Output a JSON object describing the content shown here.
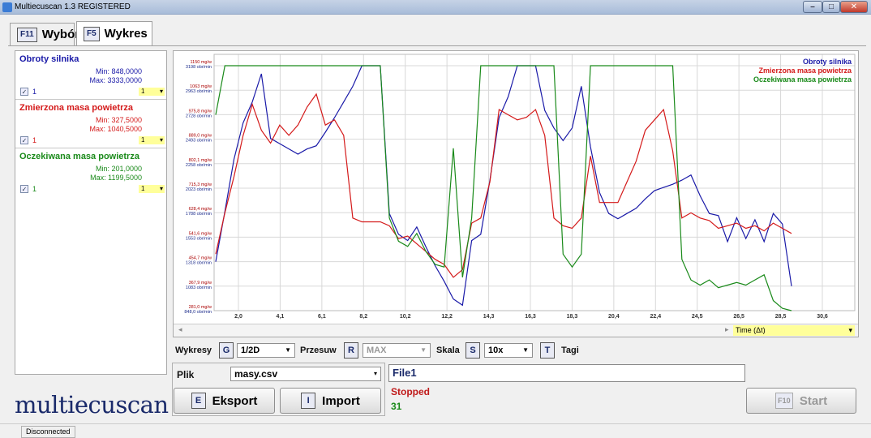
{
  "window": {
    "title": "Multiecuscan 1.3 REGISTERED"
  },
  "tabs": [
    {
      "key": "F11",
      "label": "Wybór"
    },
    {
      "key": "F5",
      "label": "Wykres"
    }
  ],
  "sensors": [
    {
      "name": "Obroty silnika",
      "min": "Min: 848,0000",
      "max": "Max: 3333,0000",
      "check": "1",
      "select": "1",
      "color": "#1a1aa8"
    },
    {
      "name": "Zmierzona masa powietrza",
      "min": "Min: 327,5000",
      "max": "Max: 1040,5000",
      "check": "1",
      "select": "1",
      "color": "#d41a1a"
    },
    {
      "name": "Oczekiwana masa powietrza",
      "min": "Min: 201,0000",
      "max": "Max: 1199,5000",
      "check": "1",
      "select": "1",
      "color": "#1a8a1a"
    }
  ],
  "chart_data": {
    "type": "line",
    "legend": [
      "Obroty silnika",
      "Zmierzona masa powietrza",
      "Oczekiwana masa powietrza"
    ],
    "legend_position": "top-right",
    "grid": true,
    "x_ticks": [
      "2,0",
      "4,1",
      "6,1",
      "8,2",
      "10,2",
      "12,2",
      "14,3",
      "16,3",
      "18,3",
      "20,4",
      "22,4",
      "24,5",
      "26,5",
      "28,5",
      "30,6"
    ],
    "y_ticks_left_mg": [
      "1150 mg/w",
      "1063 mg/w",
      "975,8 mg/w",
      "889,0 mg/w",
      "802,1 mg/w",
      "715,3 mg/w",
      "628,4 mg/w",
      "541,6 mg/w",
      "454,7 mg/w",
      "367,9 mg/w",
      "281,0 mg/w"
    ],
    "y_ticks_left_rpm": [
      "3198 obr/min",
      "2963 obr/min",
      "2728 obr/min",
      "2493 obr/min",
      "2258 obr/min",
      "2023 obr/min",
      "1788 obr/min",
      "1553 obr/min",
      "1318 obr/min",
      "1083 obr/min",
      "848,0 obr/min"
    ],
    "x_axis_label": "Time (Δt)",
    "series": [
      {
        "name": "Obroty silnika",
        "color": "#1a1aa8",
        "x": [
          0,
          1,
          2,
          3,
          4,
          5,
          6,
          7,
          8,
          9,
          10,
          11,
          12,
          13,
          14,
          15,
          16,
          17,
          18,
          19,
          20,
          21,
          22,
          23,
          24,
          25,
          26,
          27,
          28,
          29,
          30,
          31,
          32,
          33,
          34,
          35,
          36,
          37,
          38,
          39,
          40,
          41,
          42,
          43,
          44,
          45,
          46,
          47,
          48,
          49,
          50,
          51,
          52,
          53,
          54,
          55,
          56,
          57,
          58,
          59,
          60,
          61,
          62,
          63
        ],
        "y": [
          1318,
          1800,
          2300,
          2650,
          2850,
          3120,
          2500,
          2450,
          2400,
          2350,
          2400,
          2430,
          2560,
          2700,
          2850,
          3000,
          3198,
          3198,
          3198,
          1780,
          1580,
          1520,
          1650,
          1460,
          1280,
          1130,
          960,
          900,
          1520,
          1580,
          2100,
          2700,
          2900,
          3198,
          3198,
          3198,
          2770,
          2600,
          2480,
          2600,
          3000,
          2420,
          1980,
          1780,
          1730,
          1780,
          1830,
          1920,
          2000,
          2030,
          2060,
          2100,
          2150,
          1950,
          1780,
          1760,
          1510,
          1740,
          1540,
          1720,
          1510,
          1780,
          1680,
          1083
        ]
      },
      {
        "name": "Zmierzona masa powietrza",
        "color": "#d41a1a",
        "x": [
          0,
          1,
          2,
          3,
          4,
          5,
          6,
          7,
          8,
          9,
          10,
          11,
          12,
          13,
          14,
          15,
          16,
          17,
          18,
          19,
          20,
          21,
          22,
          23,
          24,
          25,
          26,
          27,
          28,
          29,
          30,
          31,
          32,
          33,
          34,
          35,
          36,
          37,
          38,
          39,
          40,
          41,
          42,
          43,
          44,
          45,
          46,
          47,
          48,
          49,
          50,
          51,
          52,
          53,
          54,
          55,
          56,
          57,
          58,
          59,
          60,
          61,
          62,
          63
        ],
        "y": [
          420,
          580,
          720,
          880,
          1000,
          900,
          850,
          920,
          880,
          920,
          990,
          1040,
          920,
          940,
          880,
          560,
          545,
          545,
          545,
          530,
          480,
          490,
          460,
          430,
          400,
          380,
          330,
          360,
          540,
          560,
          700,
          980,
          960,
          940,
          950,
          980,
          880,
          560,
          530,
          520,
          560,
          800,
          620,
          620,
          620,
          700,
          780,
          900,
          940,
          980,
          820,
          560,
          580,
          560,
          550,
          520,
          530,
          540,
          520,
          530,
          510,
          540,
          520,
          500
        ]
      },
      {
        "name": "Oczekiwana masa powietrza",
        "color": "#1a8a1a",
        "x": [
          0,
          1,
          2,
          3,
          4,
          5,
          6,
          7,
          8,
          9,
          10,
          11,
          12,
          13,
          14,
          15,
          16,
          17,
          18,
          19,
          20,
          21,
          22,
          23,
          24,
          25,
          26,
          27,
          28,
          29,
          30,
          31,
          32,
          33,
          34,
          35,
          36,
          37,
          38,
          39,
          40,
          41,
          42,
          43,
          44,
          45,
          46,
          47,
          48,
          49,
          50,
          51,
          52,
          53,
          54,
          55,
          56,
          57,
          58,
          59,
          60,
          61,
          62,
          63
        ],
        "y": [
          960,
          1199,
          1199,
          1199,
          1199,
          1199,
          1199,
          1199,
          1199,
          1199,
          1199,
          1199,
          1199,
          1199,
          1199,
          1199,
          1199,
          1199,
          1199,
          560,
          470,
          450,
          500,
          430,
          380,
          370,
          830,
          330,
          560,
          1199,
          1199,
          1199,
          1199,
          1199,
          1199,
          1199,
          1199,
          1199,
          420,
          370,
          420,
          1199,
          1199,
          1199,
          1199,
          1199,
          1199,
          1199,
          1199,
          1199,
          1199,
          400,
          320,
          300,
          320,
          290,
          300,
          310,
          300,
          320,
          340,
          240,
          210,
          201
        ]
      }
    ]
  },
  "controls": {
    "wykresy_label": "Wykresy",
    "wykresy_key": "G",
    "wykresy_value": "1/2D",
    "przesuw_label": "Przesuw",
    "przesuw_key": "R",
    "przesuw_value": "MAX",
    "skala_label": "Skala",
    "skala_key": "S",
    "skala_value": "10x",
    "tagi_key": "T",
    "tagi_label": "Tagi"
  },
  "file": {
    "plik_label": "Plik",
    "plik_value": "masy.csv",
    "eksport_key": "E",
    "eksport_label": "Eksport",
    "import_key": "I",
    "import_label": "Import",
    "name": "File1",
    "status": "Stopped",
    "count": "31",
    "start_key": "F10",
    "start_label": "Start"
  },
  "logo": "multiecuscan",
  "statusbar": {
    "status": "Disconnected"
  },
  "colors": {
    "accent": "#1a2a6a",
    "highlight": "#ffff9a"
  }
}
